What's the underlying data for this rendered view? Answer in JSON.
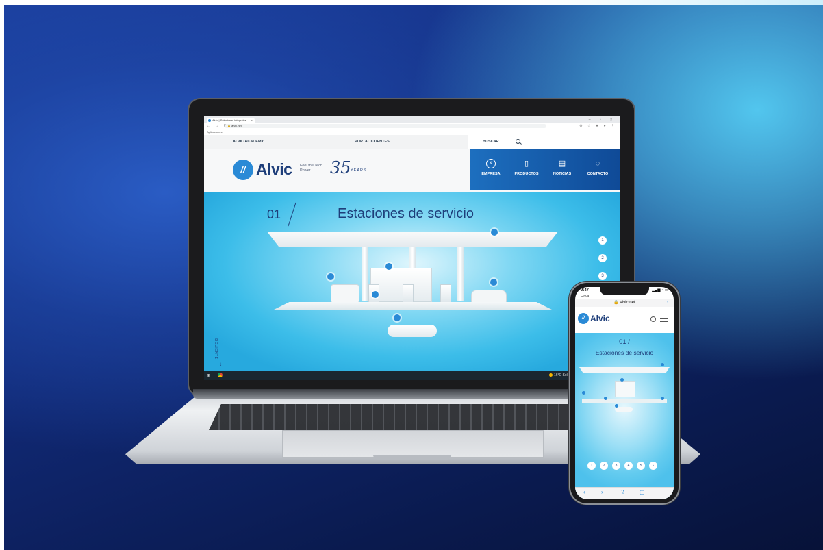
{
  "browser": {
    "tab_title": "Alvic | Soluciones integrales",
    "tab_close": "×",
    "window_controls": "– ▫ ×",
    "nav_glyphs": "← → C",
    "url": "🔒 alvic.net",
    "ext_icons": "⊕ ☆ ★ ● ⋮",
    "bookmarks": "Aplicaciones"
  },
  "site": {
    "topbar": {
      "academy": "ALVIC ACADEMY",
      "portal": "PORTAL CLIENTES",
      "search": "BUSCAR"
    },
    "brand": {
      "logo_mark": "//",
      "logo_text": "Alvic",
      "tagline": "Feel the Tech Power",
      "anniversary_num": "35",
      "anniversary_word": "YEARS"
    },
    "nav": [
      {
        "label": "EMPRESA",
        "icon": "alvic-mark-icon",
        "glyph": "//"
      },
      {
        "label": "PRODUCTOS",
        "icon": "cabinet-icon",
        "glyph": "▯"
      },
      {
        "label": "NOTICIAS",
        "icon": "news-icon",
        "glyph": "▤"
      },
      {
        "label": "CONTACTO",
        "icon": "chat-icon",
        "glyph": "◌"
      }
    ],
    "hero": {
      "number": "01",
      "title": "Estaciones de servicio",
      "side_pager": [
        "1",
        "2",
        "3"
      ],
      "scroll_label": "SIGUIENTE",
      "scroll_arrow": "↓"
    }
  },
  "taskbar": {
    "start": "⊞",
    "weather": "16°C Sol"
  },
  "phone": {
    "time": "9:47",
    "carrier": "Cerca",
    "status_right": "▂▄▆ ◔ ▭",
    "url": "🔒 alvic.net",
    "share": "⇪",
    "logo_mark": "//",
    "logo_text": "Alvic",
    "hero_number": "01 /",
    "hero_title": "Estaciones de servicio",
    "pager": [
      "1",
      "2",
      "3",
      "4",
      "5",
      "›"
    ],
    "toolbar": [
      "‹",
      "›",
      "⇪",
      "▢",
      "⋯"
    ]
  },
  "colors": {
    "brand_blue": "#2a8ad6",
    "navy": "#1e3e7a",
    "nav_gradient_end": "#0f4a97"
  }
}
